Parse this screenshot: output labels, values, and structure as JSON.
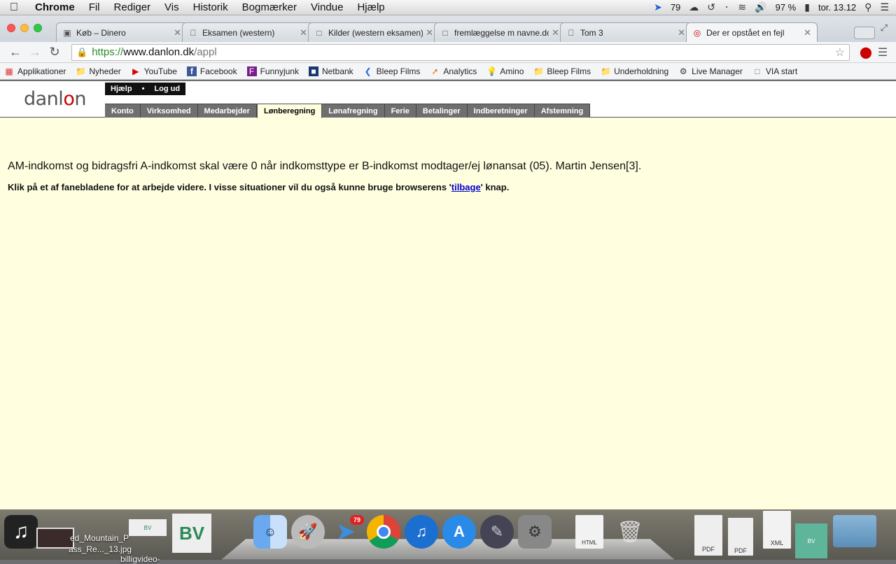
{
  "menubar": {
    "app_name": "Chrome",
    "items": [
      "Fil",
      "Rediger",
      "Vis",
      "Historik",
      "Bogmærker",
      "Vindue",
      "Hjælp"
    ],
    "status": {
      "location_count": "79",
      "battery": "97 %",
      "clock": "tor. 13.12"
    }
  },
  "tabs": [
    {
      "title": "Køb – Dinero",
      "active": false
    },
    {
      "title": "Eksamen (western)",
      "active": false
    },
    {
      "title": "Kilder (western eksamen)",
      "active": false
    },
    {
      "title": "fremlæggelse m navne.docx",
      "active": false
    },
    {
      "title": "Tom 3",
      "active": false
    },
    {
      "title": "Der er opstået en fejl",
      "active": true
    }
  ],
  "omnibox": {
    "scheme": "https://",
    "host": "www.danlon.dk",
    "path": "/appl"
  },
  "bookmarks": [
    {
      "label": "Applikationer",
      "icon": "apps-grid-icon"
    },
    {
      "label": "Nyheder",
      "icon": "folder-icon"
    },
    {
      "label": "YouTube",
      "icon": "youtube-icon"
    },
    {
      "label": "Facebook",
      "icon": "facebook-icon"
    },
    {
      "label": "Funnyjunk",
      "icon": "funnyjunk-icon"
    },
    {
      "label": "Netbank",
      "icon": "netbank-icon"
    },
    {
      "label": "Bleep Films",
      "icon": "bleep-icon"
    },
    {
      "label": "Analytics",
      "icon": "analytics-icon"
    },
    {
      "label": "Amino",
      "icon": "bulb-icon"
    },
    {
      "label": "Bleep Films",
      "icon": "folder-icon"
    },
    {
      "label": "Underholdning",
      "icon": "folder-icon"
    },
    {
      "label": "Live Manager",
      "icon": "gear-icon"
    },
    {
      "label": "VIA start",
      "icon": "page-icon"
    }
  ],
  "site": {
    "logo_text": "danlon",
    "top_links": [
      "Hjælp",
      "Log ud"
    ],
    "nav_tabs": [
      {
        "label": "Konto",
        "active": false
      },
      {
        "label": "Virksomhed",
        "active": false
      },
      {
        "label": "Medarbejder",
        "active": false
      },
      {
        "label": "Lønberegning",
        "active": true
      },
      {
        "label": "Lønafregning",
        "active": false
      },
      {
        "label": "Ferie",
        "active": false
      },
      {
        "label": "Betalinger",
        "active": false
      },
      {
        "label": "Indberetninger",
        "active": false
      },
      {
        "label": "Afstemning",
        "active": false
      }
    ],
    "error_message": "AM-indkomst og bidragsfri A-indkomst skal være 0 når indkomsttype er B-indkomst modtager/ej lønansat (05). Martin Jensen[3].",
    "help_prefix": "Klik på et af fanebladene for at arbejde videre. I visse situationer vil du også kunne bruge browserens '",
    "help_link": "tilbage",
    "help_suffix": "' knap."
  },
  "dock": {
    "labels": [
      "ed_Mountain_P",
      "ass_Re..._13.jpg",
      "billigvideo-"
    ],
    "mail_badge": "79",
    "file_labels": [
      "HTML",
      "PDF",
      "PDF",
      "XML"
    ]
  },
  "colors": {
    "page_bg": "#ffffe0",
    "nav_tab_bg": "#6f6f6f",
    "link": "#0000cc",
    "secure_green": "#2a8a2a"
  }
}
